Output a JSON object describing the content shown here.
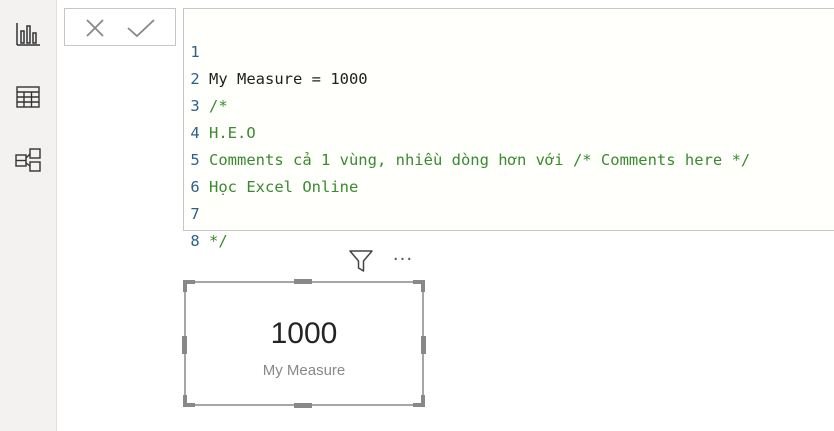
{
  "rail": {
    "items": [
      {
        "name": "report-view",
        "icon": "bar-chart-icon"
      },
      {
        "name": "data-view",
        "icon": "table-icon"
      },
      {
        "name": "model-view",
        "icon": "model-icon"
      }
    ]
  },
  "formula_bar": {
    "cancel_icon": "close-icon",
    "commit_icon": "check-icon",
    "lines": [
      {
        "num": "1",
        "text": "My Measure = 1000"
      },
      {
        "num": "2",
        "text": "/*"
      },
      {
        "num": "3",
        "text": "H.E.O"
      },
      {
        "num": "4",
        "text": "Comments cả 1 vùng, nhiều dòng hơn với /* Comments here */"
      },
      {
        "num": "5",
        "text": "Học Excel Online"
      },
      {
        "num": "6",
        "text": ""
      },
      {
        "num": "7",
        "text": "*/"
      },
      {
        "num": "8",
        "text": ""
      }
    ]
  },
  "visual_toolbar": {
    "filter_icon": "filter-icon",
    "more_options": "···"
  },
  "card": {
    "value": "1000",
    "label": "My Measure"
  },
  "colors": {
    "code": "#1f1f1f",
    "comment": "#3a8a2f",
    "line_number": "#2b5f8c",
    "editor_bg": "#fffffb"
  }
}
